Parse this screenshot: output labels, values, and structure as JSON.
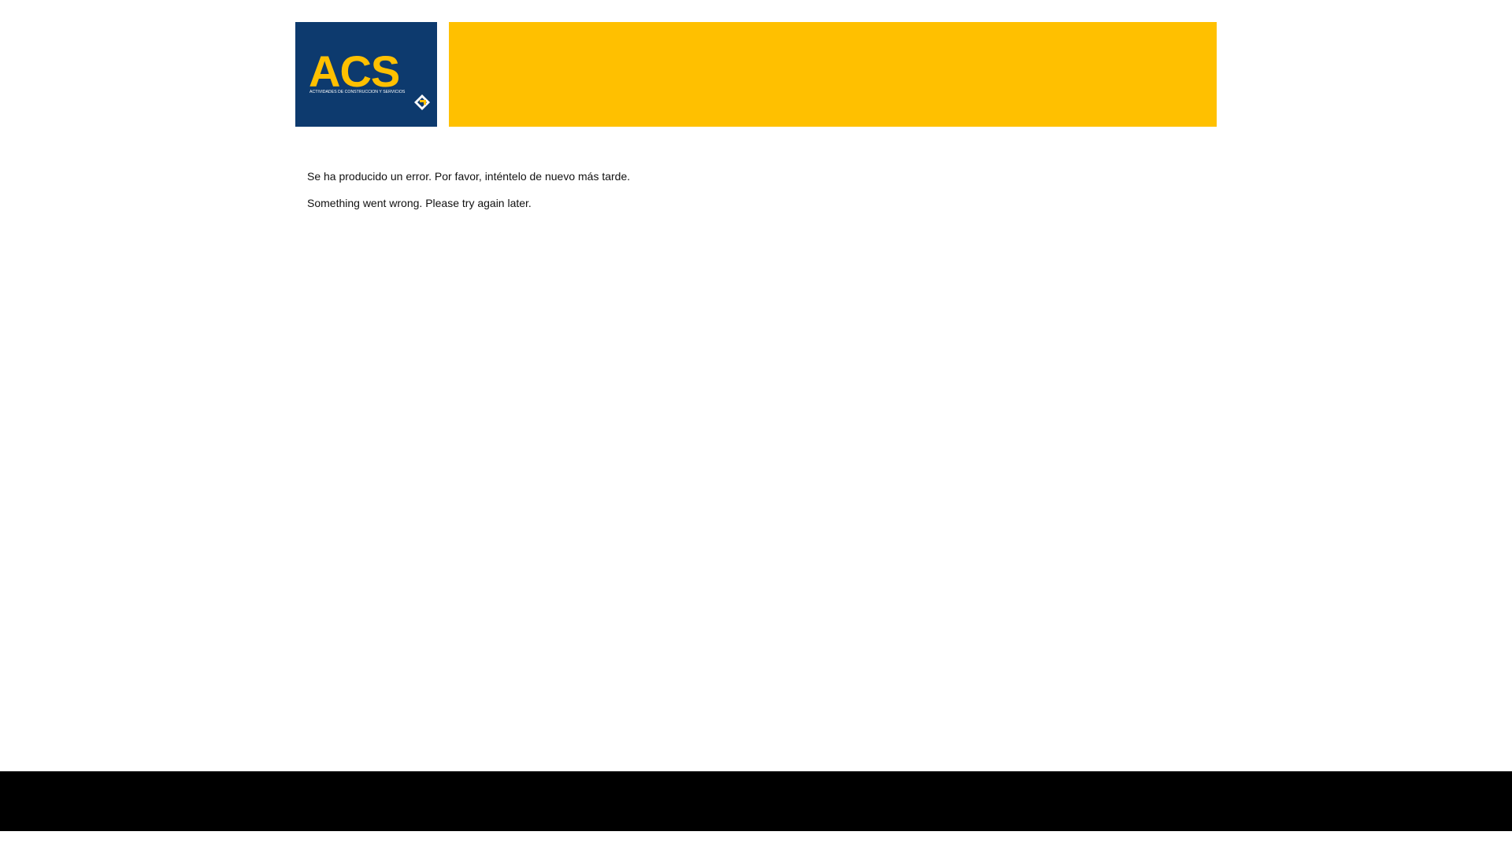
{
  "header": {
    "logo": {
      "wordmark": "ACS",
      "tagline": "ACTIVIDADES DE CONSTRUCCION Y SERVICIOS",
      "background_color": "#0d3a6e",
      "text_color": "#ffc000"
    },
    "banner_color": "#ffc000"
  },
  "messages": {
    "spanish": "Se ha producido un error. Por favor, inténtelo de nuevo más tarde.",
    "english": "Something went wrong. Please try again later."
  },
  "footer": {
    "color": "#000000"
  }
}
